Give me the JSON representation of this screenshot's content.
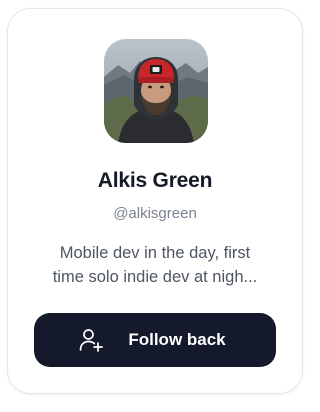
{
  "profile": {
    "avatar_alt": "Profile photo of Alkis Green",
    "name": "Alkis Green",
    "handle": "@alkisgreen",
    "bio_lines": [
      "Mobile dev in the day, first",
      "time solo indie dev at nigh..."
    ]
  },
  "action": {
    "follow_label": "Follow back",
    "icon": "user-plus-icon"
  },
  "colors": {
    "button_bg": "#141a2c",
    "name_text": "#141a26",
    "handle_text": "#7b8290",
    "bio_text": "#4e5563"
  }
}
